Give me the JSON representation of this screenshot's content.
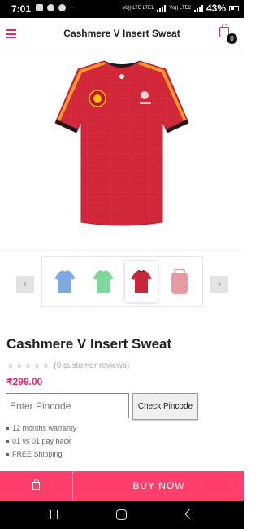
{
  "status_bar": {
    "time": "7:01",
    "carrier_1": "Vo)) LTE LTE1",
    "carrier_2": "Vo)) LTE2",
    "battery": "43%"
  },
  "header": {
    "title": "Cashmere V Insert Sweat",
    "cart_count": "0"
  },
  "gallery": {
    "thumbnails": [
      {
        "name": "blue-shirt",
        "color": "#7fa9e0"
      },
      {
        "name": "green-shirt",
        "color": "#7ed89a"
      },
      {
        "name": "red-shirt",
        "color": "#c8263a",
        "selected": true
      },
      {
        "name": "pink-shirt",
        "color": "#e89aa4"
      }
    ],
    "prev": "‹",
    "next": "›"
  },
  "product": {
    "title": "Cashmere V Insert Sweat",
    "rating_stars": 0,
    "reviews": "(0 customer reviews)",
    "price": "₹299.00"
  },
  "pincode": {
    "placeholder": "Enter Pincode",
    "button": "Check Pincode"
  },
  "features": [
    "12 months warranty",
    "01 vs 01 pay back",
    "FREE Shipping"
  ],
  "actions": {
    "buy_now": "BUY NOW"
  },
  "colors": {
    "accent": "#e8256d",
    "buy_bar": "#ff3e6c",
    "shirt_red": "#d42a3c"
  }
}
